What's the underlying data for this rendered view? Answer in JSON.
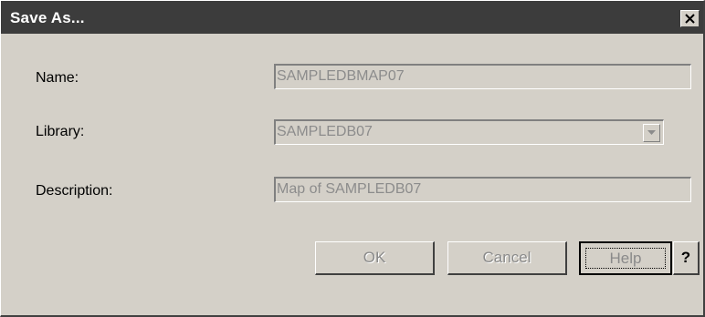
{
  "window": {
    "title": "Save As...",
    "close_label": "close"
  },
  "form": {
    "name_label": "Name:",
    "name_value": "SAMPLEDBMAP07",
    "library_label": "Library:",
    "library_value": "SAMPLEDB07",
    "description_label": "Description:",
    "description_value": "Map of SAMPLEDB07"
  },
  "buttons": {
    "ok": "OK",
    "cancel": "Cancel",
    "help": "Help",
    "context_help": "?"
  },
  "colors": {
    "titlebar": "#3c3c3c",
    "dialog_bg": "#d4d0c8",
    "disabled_text": "#8c8c8c"
  }
}
